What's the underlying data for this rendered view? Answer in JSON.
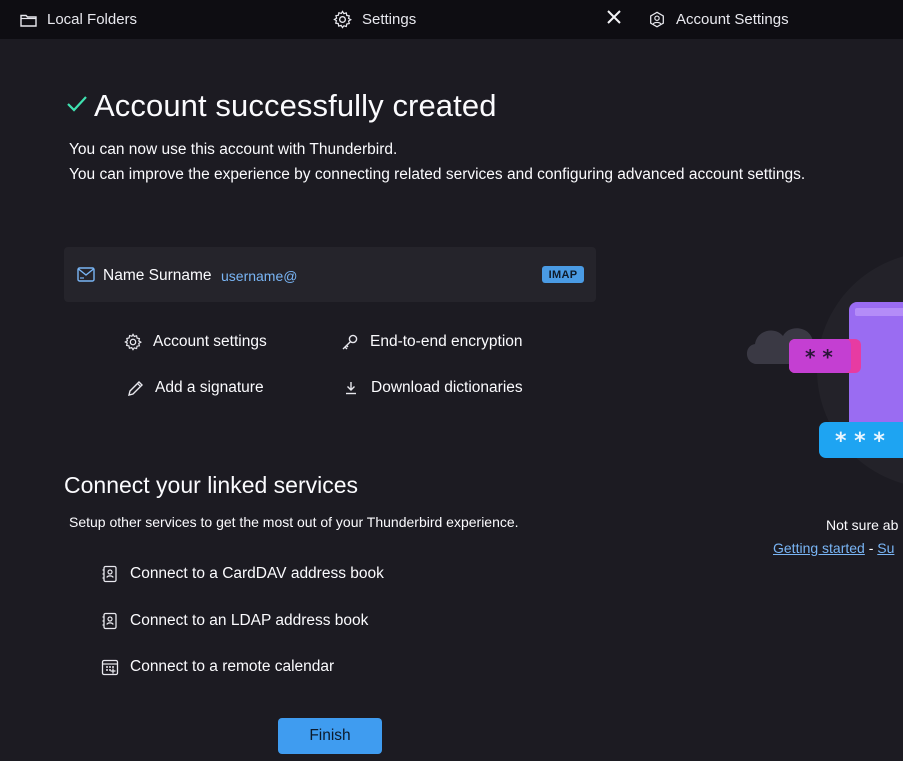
{
  "tabs": [
    {
      "label": "Local Folders",
      "icon": "folder-icon"
    },
    {
      "label": "Settings",
      "icon": "gear-icon"
    },
    {
      "label": "Account Settings",
      "icon": "account-settings-icon"
    }
  ],
  "header": {
    "title": "Account successfully created",
    "line1": "You can now use this account with Thunderbird.",
    "line2": "You can improve the experience by connecting related services and configuring advanced account settings."
  },
  "account": {
    "name": "Name Surname",
    "email": "username@",
    "protocol": "IMAP"
  },
  "actions": {
    "account_settings": "Account settings",
    "e2e": "End-to-end encryption",
    "signature": "Add a signature",
    "dictionaries": "Download dictionaries"
  },
  "linked": {
    "heading": "Connect your linked services",
    "description": "Setup other services to get the most out of your Thunderbird experience.",
    "carddav": "Connect to a CardDAV address book",
    "ldap": "Connect to an LDAP address book",
    "calendar": "Connect to a remote calendar"
  },
  "finish_label": "Finish",
  "help": {
    "text": "Not sure ab",
    "getting_started": "Getting started",
    "separator": " - ",
    "support": "Su"
  },
  "colors": {
    "background": "#1c1b22",
    "accent": "#3f9cf0",
    "link": "#79b5f5",
    "success": "#3fe1b0"
  }
}
